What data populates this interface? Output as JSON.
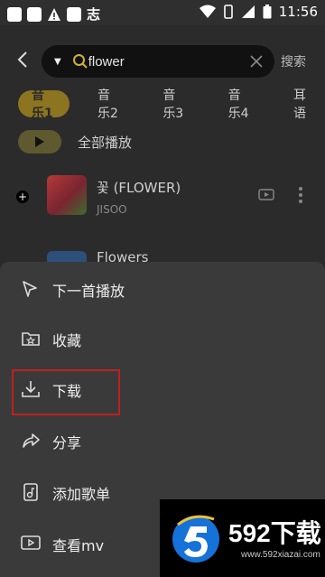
{
  "status_bar": {
    "time": "11:56",
    "left_glyph": "志"
  },
  "search": {
    "query": "flower",
    "button_label": "搜索"
  },
  "tabs": [
    "音乐1",
    "音乐2",
    "音乐3",
    "音乐4",
    "耳语"
  ],
  "play_all_label": "全部播放",
  "songs": [
    {
      "title": "꽃 (FLOWER)",
      "artist": "JISOO"
    },
    {
      "title": "Flowers"
    }
  ],
  "menu": [
    {
      "label": "下一首播放",
      "icon": "play-next-icon"
    },
    {
      "label": "收藏",
      "icon": "favorite-folder-icon"
    },
    {
      "label": "下载",
      "icon": "download-icon"
    },
    {
      "label": "分享",
      "icon": "share-icon"
    },
    {
      "label": "添加歌单",
      "icon": "add-playlist-icon"
    },
    {
      "label": "查看mv",
      "icon": "mv-icon"
    }
  ],
  "watermark": {
    "title": "592下载",
    "url": "www.592xiazai.com"
  },
  "colors": {
    "accent": "#8c7420",
    "highlight": "#c01f1f",
    "sheet": "#3a3a3a",
    "background": "#2b2b2b"
  }
}
